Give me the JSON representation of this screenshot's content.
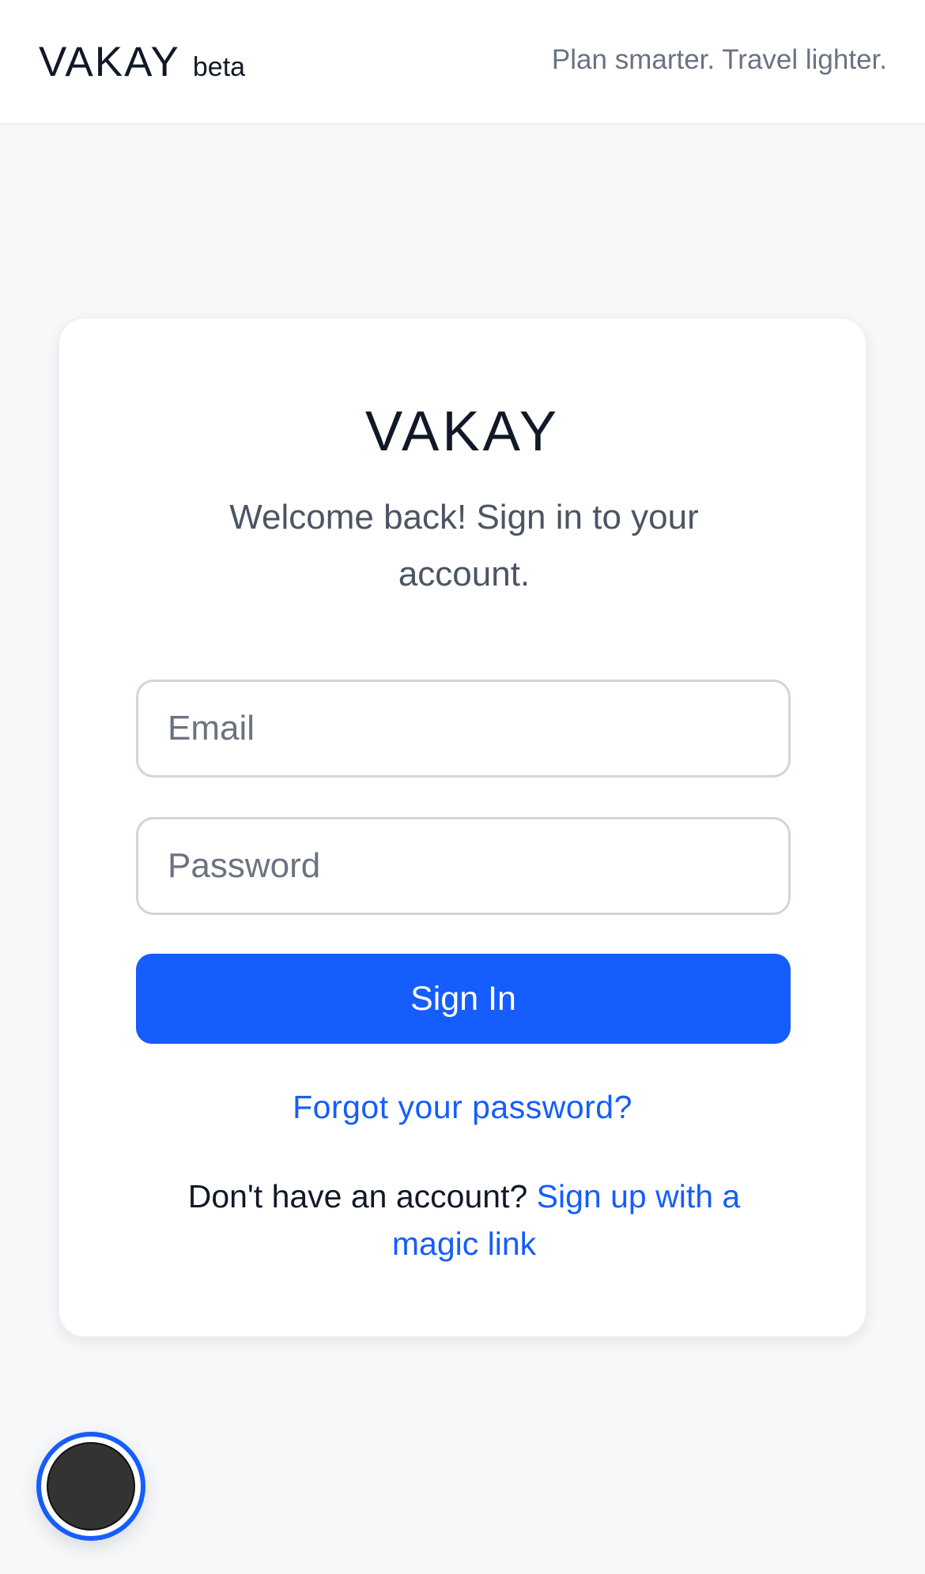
{
  "header": {
    "brand_name": "VAKAY",
    "brand_badge": "beta",
    "tagline": "Plan smarter. Travel lighter."
  },
  "login_card": {
    "title": "VAKAY",
    "subtitle": "Welcome back! Sign in to your account.",
    "email_placeholder": "Email",
    "email_value": "",
    "password_placeholder": "Password",
    "password_value": "",
    "submit_label": "Sign In",
    "forgot_label": "Forgot your password?",
    "signup_prompt": "Don't have an account? ",
    "signup_link_label": "Sign up with a magic link"
  },
  "floating_button": {
    "icon": "circle-avatar-icon"
  },
  "colors": {
    "accent": "#155dfc",
    "background": "#f7f8fa",
    "text_primary": "#111827",
    "text_muted": "#6b7280"
  }
}
